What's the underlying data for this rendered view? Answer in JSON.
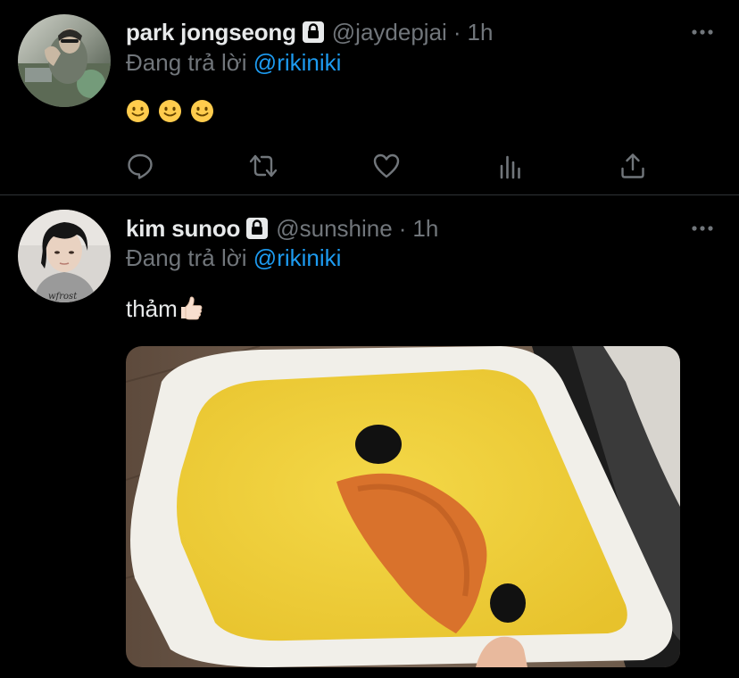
{
  "tweets": [
    {
      "display_name": "park jongseong",
      "handle": "@jaydepjai",
      "separator": "·",
      "time": "1h",
      "reply_prefix": "Đang trả lời",
      "reply_to": "@rikiniki",
      "text": "",
      "emoji": [
        "slightly-smiling-face",
        "slightly-smiling-face",
        "slightly-smiling-face"
      ],
      "protected": true
    },
    {
      "display_name": "kim sunoo",
      "handle": "@sunshine",
      "separator": "·",
      "time": "1h",
      "reply_prefix": "Đang trả lời",
      "reply_to": "@rikiniki",
      "text": "thảm",
      "emoji": [
        "thumbs-up-light-skin"
      ],
      "protected": true,
      "media": "photo-duck-bath-mat"
    }
  ],
  "actions": [
    "reply-icon",
    "retweet-icon",
    "like-icon",
    "analytics-icon",
    "share-icon"
  ],
  "colors": {
    "background": "#000000",
    "text": "#e7e9ea",
    "secondary": "#71767b",
    "link": "#1d9bf0",
    "divider": "#2f3336"
  }
}
